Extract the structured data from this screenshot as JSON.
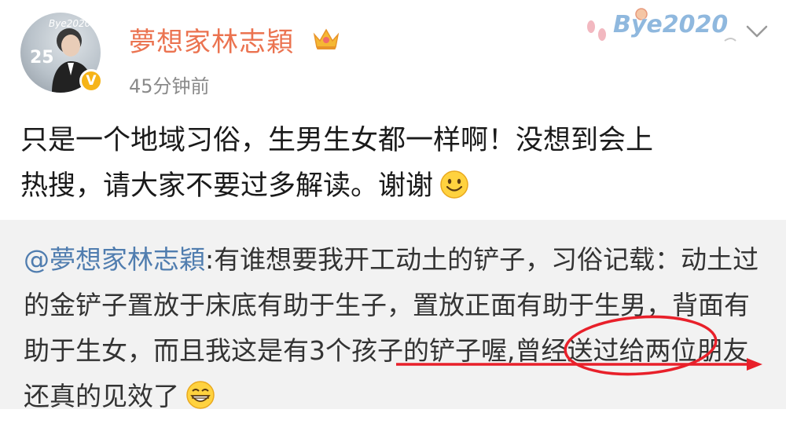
{
  "header": {
    "avatar_badge": "V",
    "username": "夢想家林志穎",
    "time": "45分钟前",
    "decoration_text": "Bye2020"
  },
  "post": {
    "line1": "只是一个地域习俗，生男生女都一样啊！没想到会上",
    "line2": "热搜，请大家不要过多解读。谢谢"
  },
  "repost": {
    "mention": "@夢想家林志穎",
    "text_part1": ":有谁想要我开工动土的铲子，习俗记载：动土过的金铲子置放于床底有助于生子，置放正面有助于生男，背面有助于生女，",
    "text_highlight": "而且我这是有3个孩子的铲",
    "text_part2": "子喔,曾经送过给两位朋友还真的见效了"
  },
  "colors": {
    "username": "#eb7350",
    "mention": "#507daf",
    "annotation_red": "#e8202a",
    "repost_bg": "#f2f2f2"
  }
}
